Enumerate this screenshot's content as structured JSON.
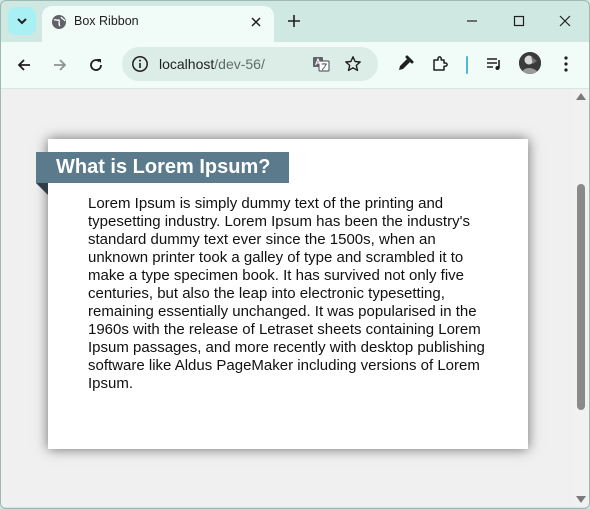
{
  "browser": {
    "tab": {
      "title": "Box Ribbon"
    },
    "address": {
      "host": "localhost",
      "path": "/dev-56/"
    },
    "icons": {
      "tab_menu": "chevron-down-icon",
      "favicon": "globe-icon",
      "tab_close": "close-icon",
      "new_tab": "plus-icon",
      "minimize": "minimize-icon",
      "maximize": "maximize-icon",
      "close": "close-icon",
      "back": "arrow-left-icon",
      "forward": "arrow-right-icon",
      "reload": "reload-icon",
      "site_info": "info-icon",
      "translate": "translate-icon",
      "bookmark": "star-icon",
      "eyedropper": "eyedropper-icon",
      "extensions": "puzzle-icon",
      "media": "playlist-icon",
      "profile": "avatar",
      "menu": "kebab-menu-icon"
    }
  },
  "page": {
    "ribbon_title": "What is Lorem Ipsum?",
    "body_text": "Lorem Ipsum is simply dummy text of the printing and typesetting industry. Lorem Ipsum has been the industry's standard dummy text ever since the 1500s, when an unknown printer took a galley of type and scrambled it to make a type specimen book. It has survived not only five centuries, but also the leap into electronic typesetting, remaining essentially unchanged. It was popularised in the 1960s with the release of Letraset sheets containing Lorem Ipsum passages, and more recently with desktop publishing software like Aldus PageMaker including versions of Lorem Ipsum."
  },
  "colors": {
    "ribbon": "#5b7b8c",
    "ribbon_fold": "#2e3d46",
    "chrome": "#cfe8e2",
    "toolbar": "#f1fbf8"
  }
}
